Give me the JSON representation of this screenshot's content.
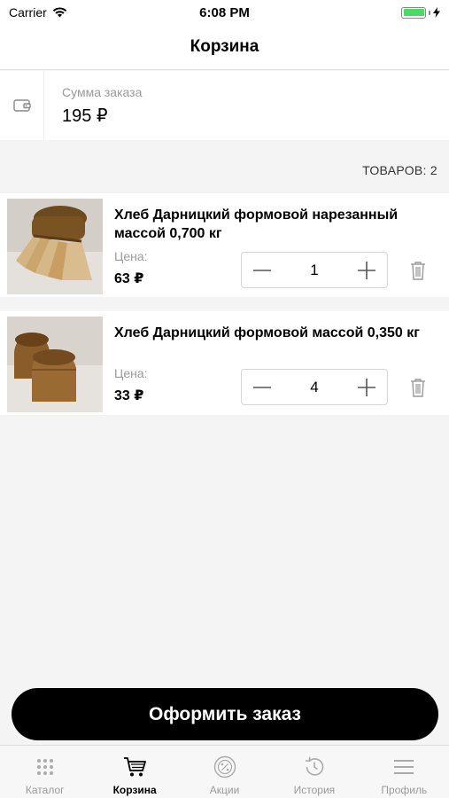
{
  "status_bar": {
    "carrier": "Carrier",
    "time": "6:08 PM"
  },
  "nav": {
    "title": "Корзина"
  },
  "summary": {
    "label": "Сумма заказа",
    "value": "195 ₽"
  },
  "items_count": "ТОВАРОВ: 2",
  "items": [
    {
      "title": "Хлеб Дарницкий формовой нарезанный массой 0,700 кг",
      "price_label": "Цена:",
      "price": "63 ₽",
      "quantity": "1"
    },
    {
      "title": "Хлеб Дарницкий формовой массой 0,350 кг",
      "price_label": "Цена:",
      "price": "33 ₽",
      "quantity": "4"
    }
  ],
  "checkout_label": "Оформить заказ",
  "tabs": [
    {
      "label": "Каталог",
      "icon": "grid-dots-icon"
    },
    {
      "label": "Корзина",
      "icon": "cart-icon",
      "active": true
    },
    {
      "label": "Акции",
      "icon": "percent-badge-icon"
    },
    {
      "label": "История",
      "icon": "history-icon"
    },
    {
      "label": "Профиль",
      "icon": "menu-icon"
    }
  ],
  "colors": {
    "battery": "#4cd964",
    "accent": "#000000",
    "muted": "#9a9a9a"
  }
}
